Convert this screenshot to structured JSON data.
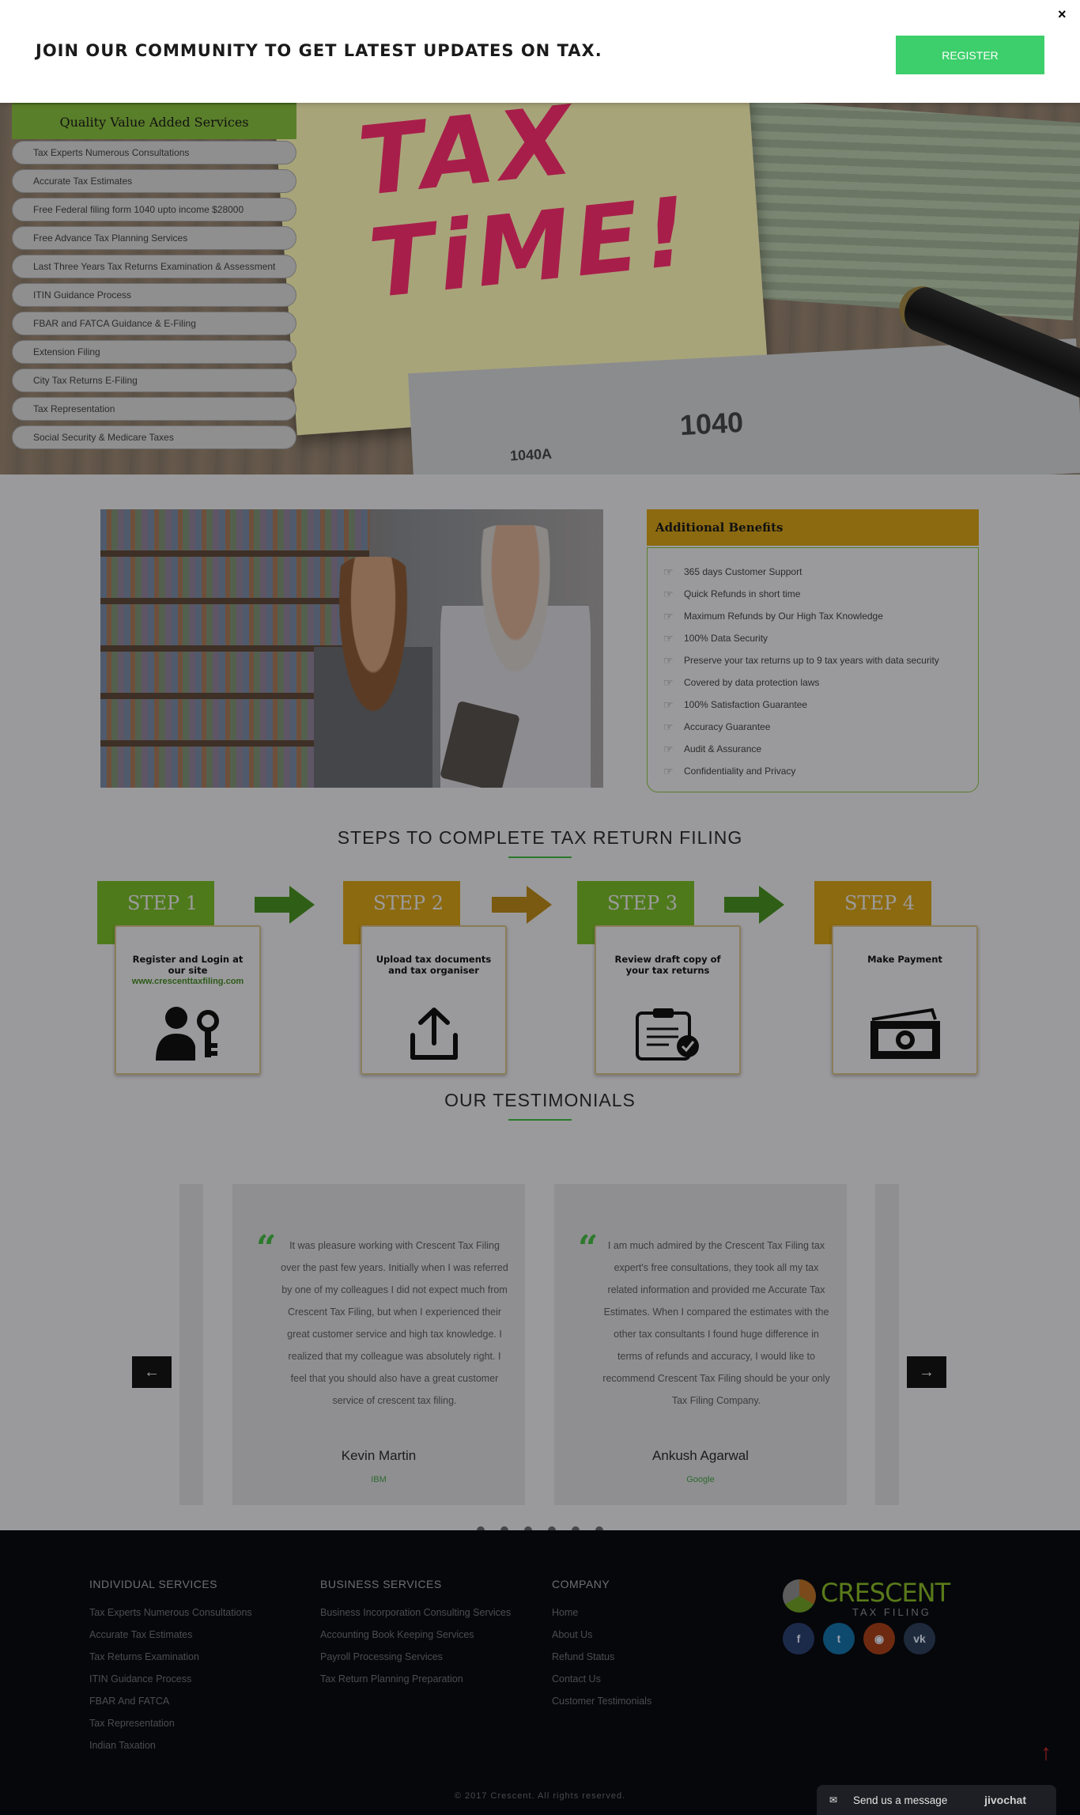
{
  "banner": {
    "text": "JOIN OUR COMMUNITY TO GET LATEST UPDATES ON TAX.",
    "register_label": "REGISTER",
    "close_label": "×"
  },
  "hero": {
    "note_text_line1": "TAX",
    "note_text_line2": "TiME!",
    "form_label": "1040",
    "form_label_small": "1040A"
  },
  "services": {
    "title": "Quality Value Added Services",
    "items": [
      "Tax Experts Numerous Consultations",
      "Accurate Tax Estimates",
      "Free Federal filing form 1040 upto income $28000",
      "Free Advance Tax Planning Services",
      "Last Three Years Tax Returns Examination & Assessment",
      "ITIN Guidance Process",
      "FBAR and FATCA Guidance & E-Filing",
      "Extension Filing",
      "City Tax Returns E-Filing",
      "Tax Representation",
      "Social Security & Medicare Taxes"
    ]
  },
  "benefits": {
    "title": "Additional Benefits",
    "items": [
      "365 days Customer Support",
      "Quick Refunds in short time",
      "Maximum Refunds by Our High Tax Knowledge",
      "100% Data Security",
      "Preserve your tax returns up to 9 tax years with data security",
      "Covered by data protection laws",
      "100% Satisfaction Guarantee",
      "Accuracy Guarantee",
      "Audit & Assurance",
      "Confidentiality and Privacy"
    ]
  },
  "steps": {
    "title": "STEPS TO COMPLETE TAX RETURN FILING",
    "items": [
      {
        "label": "STEP 1",
        "text": "Register and Login at  our site",
        "link": "www.crescenttaxfiling.com",
        "color": "#4f7a1c"
      },
      {
        "label": "STEP 2",
        "text": "Upload tax documents and tax organiser",
        "link": "",
        "color": "#8c6a10"
      },
      {
        "label": "STEP 3",
        "text": "Review draft copy of your tax returns",
        "link": "",
        "color": "#4f7a1c"
      },
      {
        "label": "STEP 4",
        "text": "Make Payment",
        "link": "",
        "color": "#8c6a10"
      }
    ],
    "icons": [
      "user-key-icon",
      "upload-icon",
      "clipboard-check-icon",
      "cash-icon"
    ]
  },
  "testimonials": {
    "title": "OUR TESTIMONIALS",
    "quote_mark": "“",
    "items": [
      {
        "text": "It was pleasure working with Crescent Tax Filing over the past few years. Initially when I was referred by one of my colleagues I did not expect much from Crescent Tax Filing, but when I experienced their great customer service and high tax knowledge. I realized that my colleague was absolutely right. I feel that you should also have a great customer service of crescent tax filing.",
        "name": "Kevin Martin",
        "company": "IBM"
      },
      {
        "text": "I am much admired by the Crescent Tax Filing tax expert's free consultations, they took all my tax related information and provided me Accurate Tax Estimates. When I compared the estimates with the other tax consultants I found huge difference in terms of refunds and accuracy, I would like to recommend Crescent Tax Filing should be your only Tax Filing Company.",
        "name": "Ankush Agarwal",
        "company": "Google"
      }
    ],
    "prev_label": "←",
    "next_label": "→"
  },
  "footer": {
    "individual": {
      "title": "INDIVIDUAL SERVICES",
      "links": [
        "Tax Experts Numerous Consultations",
        "Accurate Tax Estimates",
        "Tax Returns Examination",
        "ITIN Guidance Process",
        "FBAR And FATCA",
        "Tax Representation",
        "Indian Taxation"
      ]
    },
    "business": {
      "title": "BUSINESS SERVICES",
      "links": [
        "Business Incorporation Consulting Services",
        "Accounting Book Keeping Services",
        "Payroll Processing Services",
        "Tax Return Planning Preparation"
      ]
    },
    "company": {
      "title": "COMPANY",
      "links": [
        "Home",
        "About Us",
        "Refund Status",
        "Contact Us",
        "Customer Testimonials"
      ]
    },
    "logo": {
      "name": "CRESCENT",
      "sub": "TAX FILING"
    },
    "socials": [
      {
        "icon": "facebook-icon",
        "glyph": "f",
        "color": "#1c2a4a"
      },
      {
        "icon": "twitter-icon",
        "glyph": "t",
        "color": "#0d4a6e"
      },
      {
        "icon": "rss-icon",
        "glyph": "◉",
        "color": "#6e2a10"
      },
      {
        "icon": "vk-icon",
        "glyph": "vk",
        "color": "#1e2a3c"
      }
    ],
    "copyright": "© 2017 Crescent. All rights reserved.",
    "scroll_top": "↑"
  },
  "chat": {
    "text": "Send us a message",
    "brand": "jivochat"
  }
}
